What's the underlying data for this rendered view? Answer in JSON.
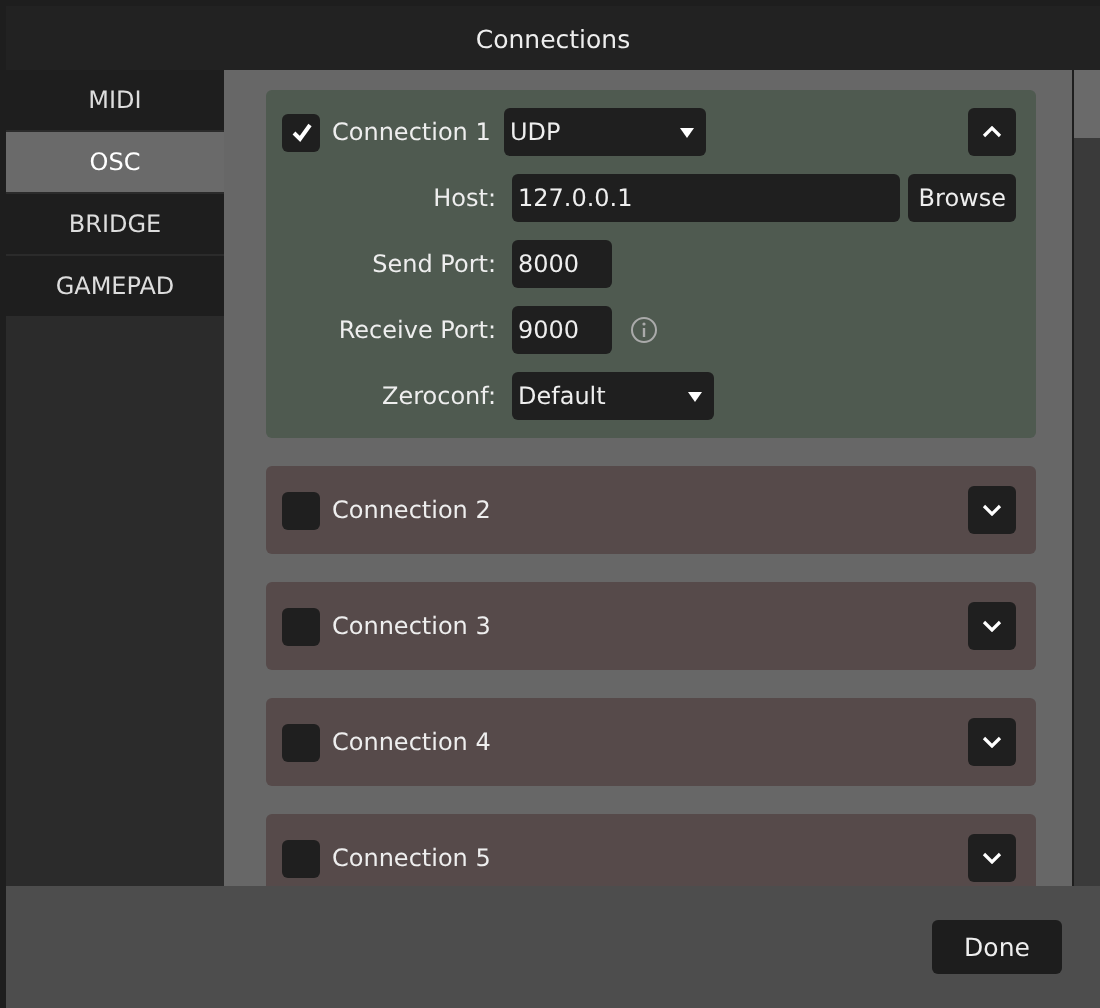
{
  "window": {
    "title": "Connections"
  },
  "tabs": [
    {
      "label": "MIDI",
      "selected": false
    },
    {
      "label": "OSC",
      "selected": true
    },
    {
      "label": "BRIDGE",
      "selected": false
    },
    {
      "label": "GAMEPAD",
      "selected": false
    }
  ],
  "connections": [
    {
      "name": "Connection 1",
      "checked": true,
      "expanded": true,
      "protocol": "UDP",
      "host": {
        "label": "Host:",
        "value": "127.0.0.1",
        "button": "Browse"
      },
      "send_port": {
        "label": "Send Port:",
        "value": "8000"
      },
      "receive_port": {
        "label": "Receive Port:",
        "value": "9000"
      },
      "zeroconf": {
        "label": "Zeroconf:",
        "value": "Default"
      }
    },
    {
      "name": "Connection 2",
      "checked": false,
      "expanded": false
    },
    {
      "name": "Connection 3",
      "checked": false,
      "expanded": false
    },
    {
      "name": "Connection 4",
      "checked": false,
      "expanded": false
    },
    {
      "name": "Connection 5",
      "checked": false,
      "expanded": false
    }
  ],
  "footer": {
    "button": "Done"
  }
}
